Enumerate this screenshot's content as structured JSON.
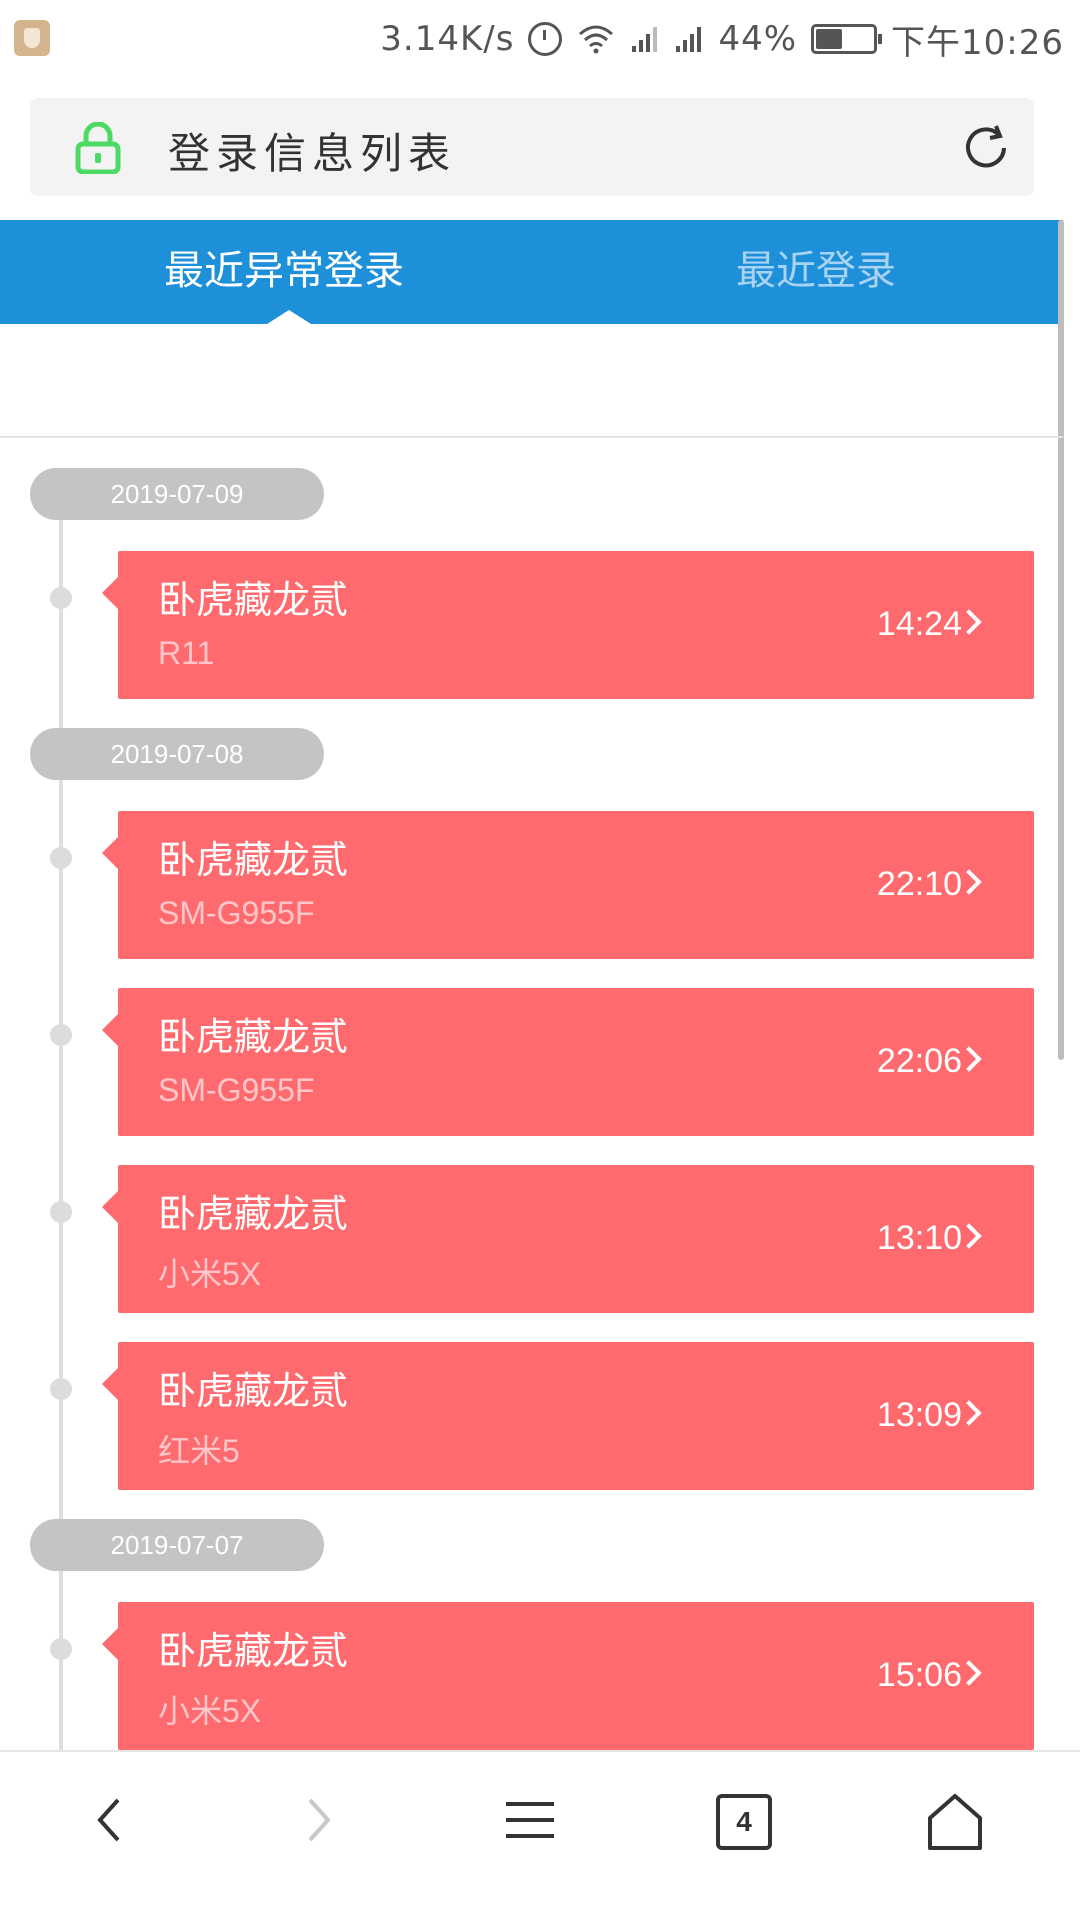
{
  "status_bar": {
    "speed": "3.14K/s",
    "battery": "44%",
    "time": "下午10:26"
  },
  "address_bar": {
    "title": "登录信息列表"
  },
  "tabs": [
    {
      "label": "最近异常登录",
      "active": true
    },
    {
      "label": "最近登录",
      "active": false
    }
  ],
  "groups": [
    {
      "date": "2019-07-09",
      "items": [
        {
          "title": "卧虎藏龙贰",
          "device": "R11",
          "time": "14:24"
        }
      ]
    },
    {
      "date": "2019-07-08",
      "items": [
        {
          "title": "卧虎藏龙贰",
          "device": "SM-G955F",
          "time": "22:10"
        },
        {
          "title": "卧虎藏龙贰",
          "device": "SM-G955F",
          "time": "22:06"
        },
        {
          "title": "卧虎藏龙贰",
          "device": "小米5X",
          "time": "13:10"
        },
        {
          "title": "卧虎藏龙贰",
          "device": "红米5",
          "time": "13:09"
        }
      ]
    },
    {
      "date": "2019-07-07",
      "items": [
        {
          "title": "卧虎藏龙贰",
          "device": "小米5X",
          "time": "15:06"
        }
      ]
    }
  ],
  "bottom_nav": {
    "tab_count": "4",
    "icons": [
      "back-icon",
      "forward-icon",
      "menu-icon",
      "tabs-icon",
      "home-icon"
    ]
  },
  "colors": {
    "tab_bar": "#1e8fd9",
    "card": "#ff6a6e",
    "date_pill": "#c4c4c4",
    "lock": "#4cd964"
  }
}
